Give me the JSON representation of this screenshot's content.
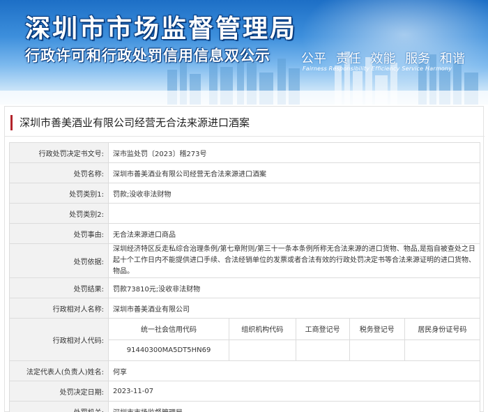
{
  "header": {
    "title": "深圳市市场监督管理局",
    "subtitle": "行政许可和行政处罚信用信息双公示",
    "motto_cn": "公平 责任 效能 服务 和谐",
    "motto_en": "Fairness Responsibility Efficiency Service Harmony"
  },
  "case": {
    "title": "深圳市善美酒业有限公司经营无合法来源进口酒案"
  },
  "fields": {
    "doc_no": {
      "label": "行政处罚决定书文号:",
      "value": "深市监处罚〔2023〕稽273号"
    },
    "case_name": {
      "label": "处罚名称:",
      "value": "深圳市善美酒业有限公司经营无合法来源进口酒案"
    },
    "category1": {
      "label": "处罚类别1:",
      "value": "罚款;没收非法财物"
    },
    "category2": {
      "label": "处罚类别2:",
      "value": ""
    },
    "reason": {
      "label": "处罚事由:",
      "value": "无合法来源进口商品"
    },
    "basis": {
      "label": "处罚依据:",
      "value": "深圳经济特区反走私综合治理条例/第七章附则/第三十一条本条例所称无合法来源的进口货物、物品,是指自被查处之日起十个工作日内不能提供进口手续、合法经销单位的发票或者合法有效的行政处罚决定书等合法来源证明的进口货物、物品。"
    },
    "result": {
      "label": "处罚结果:",
      "value": "罚款73810元;没收非法财物"
    },
    "party": {
      "label": "行政相对人名称:",
      "value": "深圳市善美酒业有限公司"
    },
    "codes_label": "行政相对人代码:",
    "legal_rep": {
      "label": "法定代表人(负责人)姓名:",
      "value": "何享"
    },
    "decision_date": {
      "label": "处罚决定日期:",
      "value": "2023-11-07"
    },
    "authority": {
      "label": "处罚机关:",
      "value": "深圳市市场监督管理局"
    }
  },
  "codes": {
    "headers": [
      "统一社会信用代码",
      "组织机构代码",
      "工商登记号",
      "税务登记号",
      "居民身份证号码"
    ],
    "values": [
      "91440300MA5DT5HN69",
      "",
      "",
      "",
      ""
    ]
  },
  "colors": {
    "accent": "#b3232a",
    "label_bg": "#f2f2f2",
    "border": "#dcdcdc",
    "banner_blue": "#1d6fc6"
  }
}
